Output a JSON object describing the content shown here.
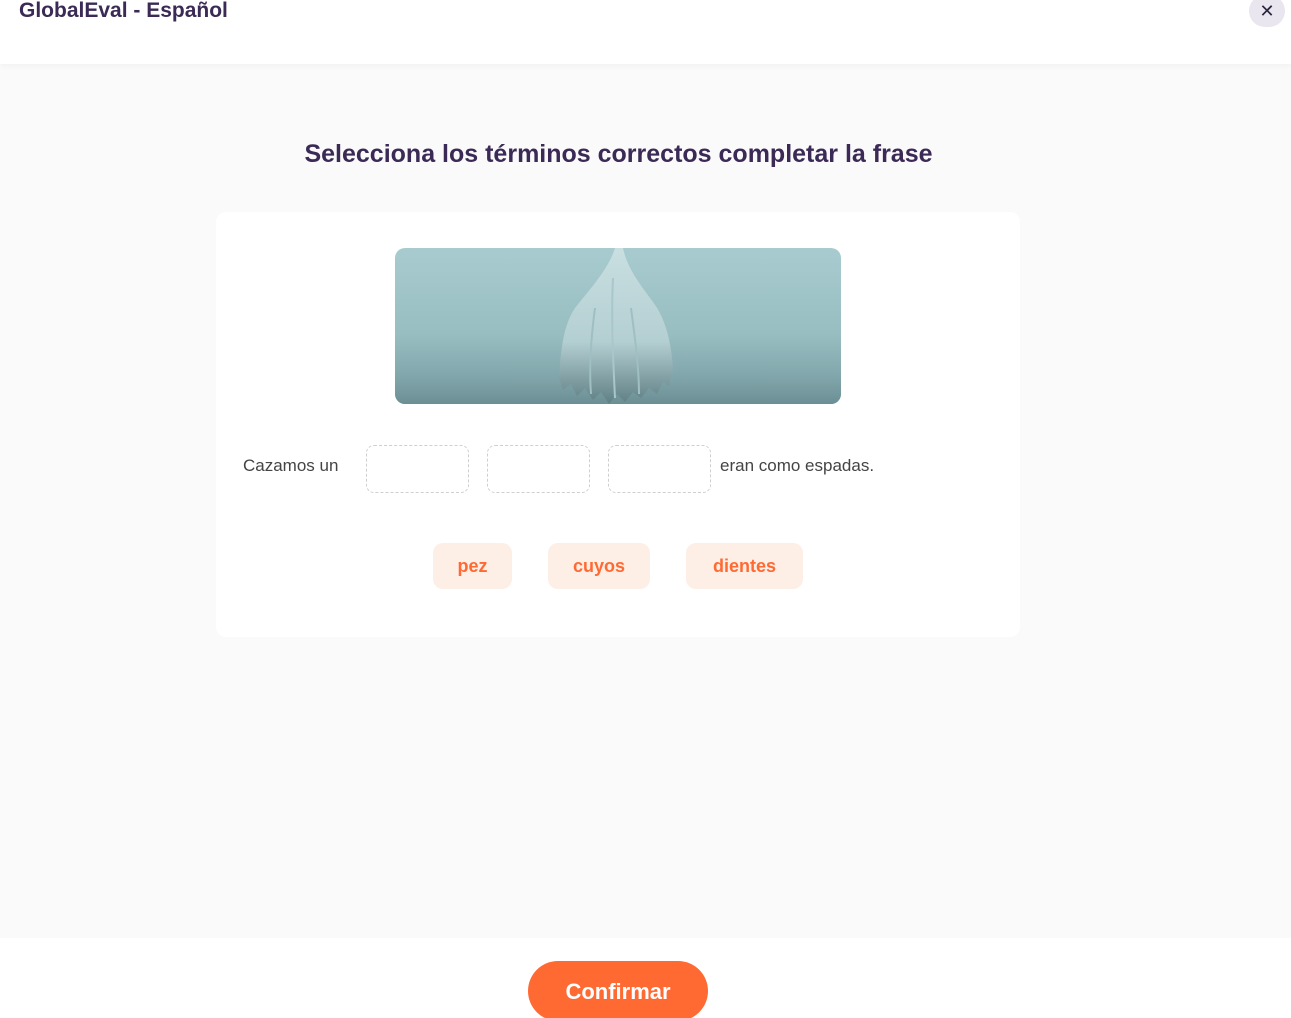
{
  "header": {
    "title": "GlobalEval - Español",
    "close_icon": "close-icon"
  },
  "question": {
    "prompt": "Selecciona los términos correctos completar la frase",
    "image_description_icon": "ghost-photo",
    "sentence_start": "Cazamos un",
    "sentence_end": "eran como espadas.",
    "blank_count": 3,
    "options": [
      "pez",
      "cuyos",
      "dientes"
    ]
  },
  "footer": {
    "confirm_label": "Confirmar"
  },
  "colors": {
    "brand_dark": "#3b2a55",
    "accent_orange": "#ff6a33",
    "chip_bg": "#fdeee6"
  }
}
